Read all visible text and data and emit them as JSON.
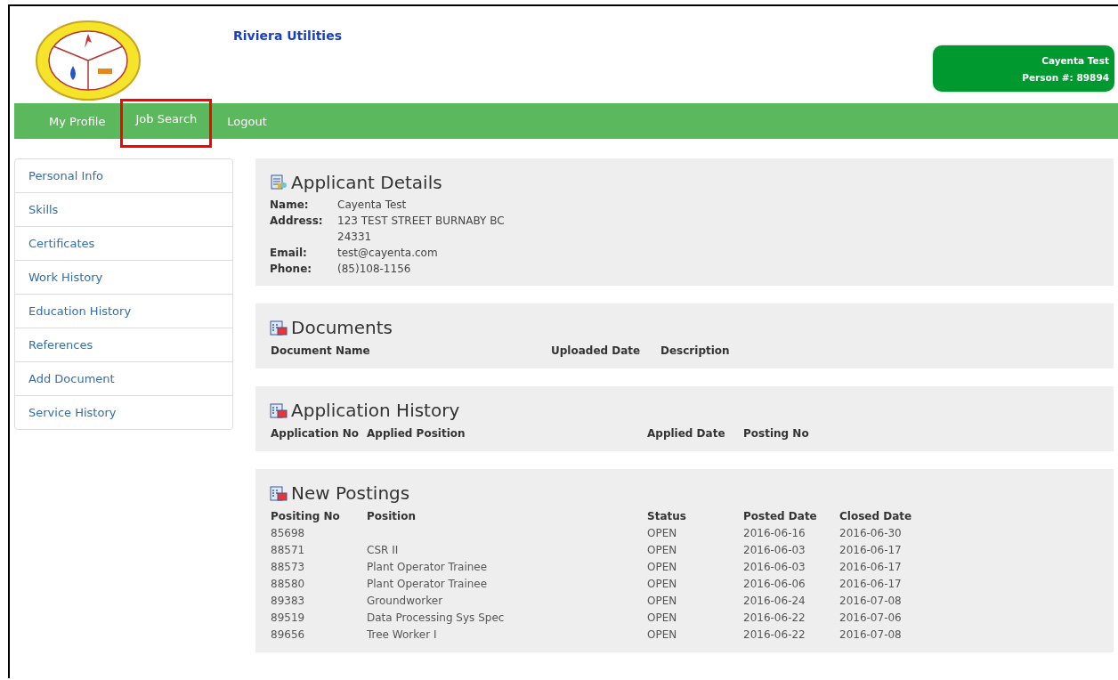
{
  "header": {
    "site_title": "Riviera Utilities",
    "user": {
      "name": "Cayenta Test",
      "person": "Person #: 89894"
    }
  },
  "nav": [
    {
      "label": "My Profile",
      "highlighted": false
    },
    {
      "label": "Job Search",
      "highlighted": true
    },
    {
      "label": "Logout",
      "highlighted": false
    }
  ],
  "sidebar": {
    "items": [
      "Personal Info",
      "Skills",
      "Certificates",
      "Work History",
      "Education History",
      "References",
      "Add Document",
      "Service History"
    ]
  },
  "panels": [
    {
      "kind": "details",
      "title": "Applicant Details",
      "fields": [
        {
          "label": "Name:",
          "value": "Cayenta Test"
        },
        {
          "label": "Address:",
          "value": "123 TEST STREET BURNABY BC",
          "extra": "24331"
        },
        {
          "label": "Email:",
          "value": "test@cayenta.com"
        },
        {
          "label": "Phone:",
          "value": "(85)108-1156"
        }
      ]
    },
    {
      "kind": "table",
      "title": "Documents",
      "columns": [
        "Document Name",
        "Uploaded Date",
        "Description"
      ]
    },
    {
      "kind": "table",
      "title": "Application History",
      "columns": [
        "Application No",
        "Applied Position",
        "Applied Date",
        "Posting No"
      ]
    },
    {
      "kind": "table",
      "title": "New Postings",
      "columns": [
        "Positing No",
        "Position",
        "Status",
        "Posted Date",
        "Closed Date"
      ],
      "rows": [
        [
          "85698",
          null,
          "OPEN",
          "2016-06-16",
          "2016-06-30"
        ],
        [
          "88571",
          "CSR II",
          "OPEN",
          "2016-06-03",
          "2016-06-17"
        ],
        [
          "88573",
          "Plant Operator Trainee",
          "OPEN",
          "2016-06-03",
          "2016-06-17"
        ],
        [
          "88580",
          "Plant Operator Trainee",
          "OPEN",
          "2016-06-06",
          "2016-06-17"
        ],
        [
          "89383",
          "Groundworker",
          "OPEN",
          "2016-06-24",
          "2016-07-08"
        ],
        [
          "89519",
          "Data Processing Sys Spec",
          "OPEN",
          "2016-06-22",
          "2016-07-06"
        ],
        [
          "89656",
          "Tree Worker I",
          "OPEN",
          "2016-06-22",
          "2016-07-08"
        ]
      ]
    }
  ]
}
